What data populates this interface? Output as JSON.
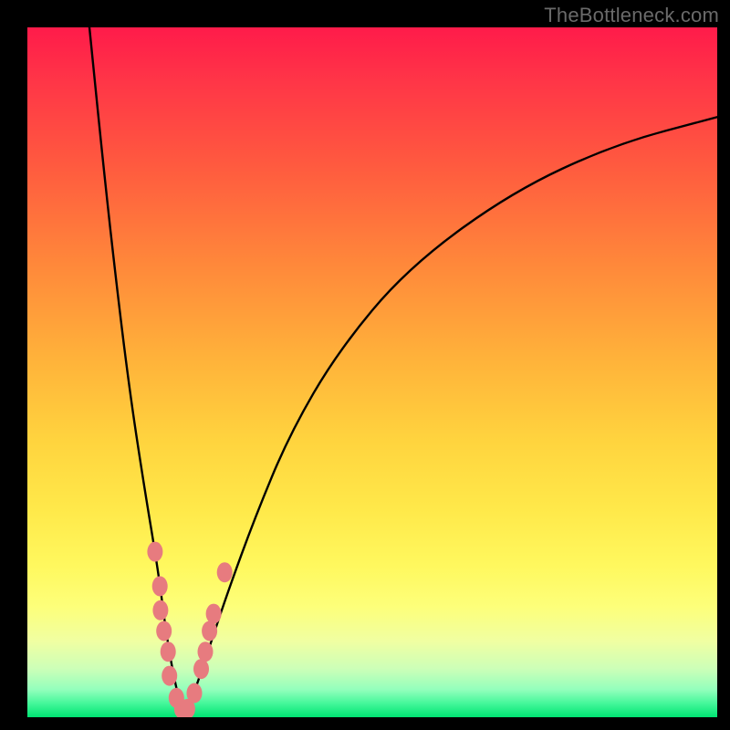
{
  "watermark": "TheBottleneck.com",
  "colors": {
    "bead": "#e77b7f",
    "curve": "#000000"
  },
  "chart_data": {
    "type": "line",
    "title": "",
    "xlabel": "",
    "ylabel": "",
    "xlim": [
      0,
      100
    ],
    "ylim": [
      0,
      100
    ],
    "grid": false,
    "legend": false,
    "note": "No axis ticks or numeric labels are rendered in the image; x/y values below are estimated as percent of the plot area (0 = left/bottom, 100 = right/top).",
    "series": [
      {
        "name": "left-branch",
        "x": [
          9,
          11,
          13,
          15,
          17,
          19,
          20,
          21,
          22,
          22.5
        ],
        "y": [
          100,
          80,
          62,
          46,
          33,
          21,
          13,
          7,
          2.5,
          0
        ]
      },
      {
        "name": "right-branch",
        "x": [
          22.5,
          24,
          26,
          29,
          33,
          38,
          45,
          55,
          70,
          85,
          100
        ],
        "y": [
          0,
          3,
          9,
          18,
          29,
          41,
          53,
          65,
          76,
          83,
          87
        ]
      }
    ],
    "markers": {
      "name": "beads",
      "color": "#e77b7f",
      "points": [
        {
          "x": 18.5,
          "y": 24
        },
        {
          "x": 19.2,
          "y": 19
        },
        {
          "x": 19.3,
          "y": 15.5
        },
        {
          "x": 19.8,
          "y": 12.5
        },
        {
          "x": 20.4,
          "y": 9.5
        },
        {
          "x": 20.6,
          "y": 6
        },
        {
          "x": 21.6,
          "y": 2.8
        },
        {
          "x": 22.4,
          "y": 1.2
        },
        {
          "x": 23.2,
          "y": 1.2
        },
        {
          "x": 24.2,
          "y": 3.5
        },
        {
          "x": 25.2,
          "y": 7
        },
        {
          "x": 25.8,
          "y": 9.5
        },
        {
          "x": 26.4,
          "y": 12.5
        },
        {
          "x": 27.0,
          "y": 15
        },
        {
          "x": 28.6,
          "y": 21
        }
      ]
    }
  }
}
